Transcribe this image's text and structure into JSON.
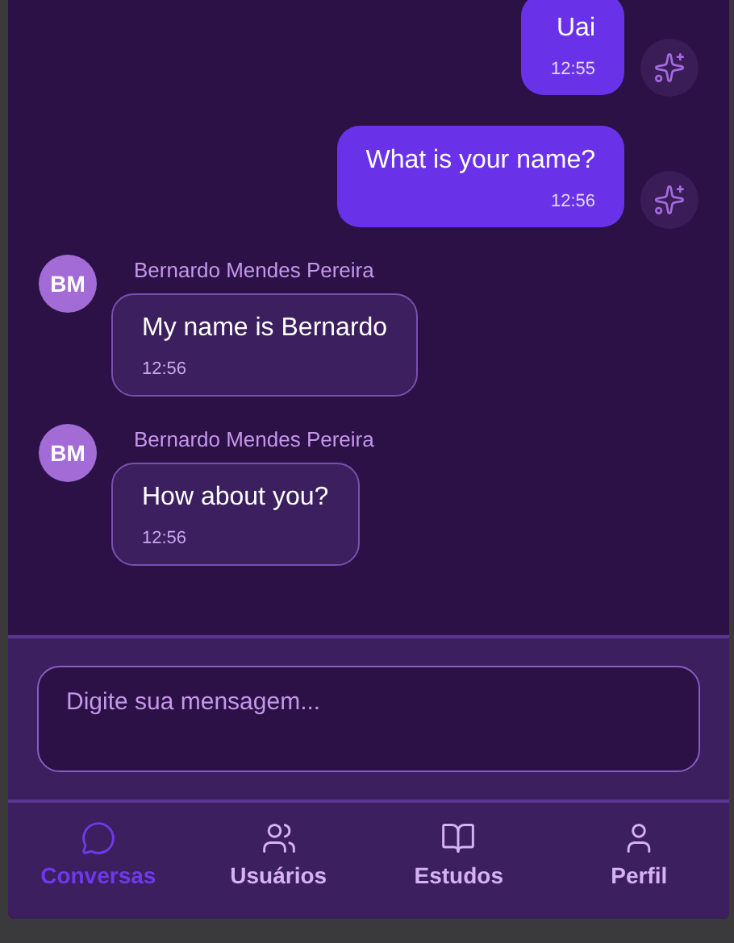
{
  "messages": [
    {
      "kind": "sent",
      "text": "Uai",
      "time": "12:55"
    },
    {
      "kind": "sent",
      "text": "What is your name?",
      "time": "12:56"
    },
    {
      "kind": "received",
      "initials": "BM",
      "sender": "Bernardo Mendes Pereira",
      "text": "My name is Bernardo",
      "time": "12:56"
    },
    {
      "kind": "received",
      "initials": "BM",
      "sender": "Bernardo Mendes Pereira",
      "text": "How about you?",
      "time": "12:56"
    }
  ],
  "composer": {
    "placeholder": "Digite sua mensagem..."
  },
  "nav": [
    {
      "label": "Conversas",
      "selected": true
    },
    {
      "label": "Usuários",
      "selected": false
    },
    {
      "label": "Estudos",
      "selected": false
    },
    {
      "label": "Perfil",
      "selected": false
    }
  ]
}
